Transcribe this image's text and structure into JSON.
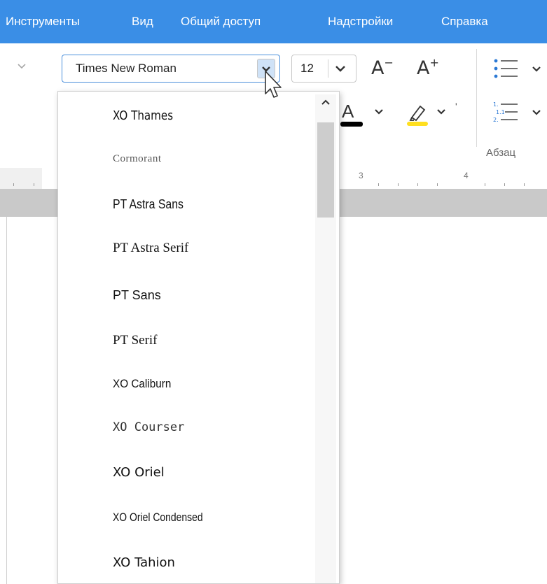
{
  "menubar": {
    "items": [
      "Инструменты",
      "Вид",
      "Общий доступ",
      "Надстройки",
      "Справка"
    ]
  },
  "toolbar": {
    "font_name": {
      "value": "Times New Roman"
    },
    "font_size": {
      "value": "12"
    },
    "decrease_font_label": "A",
    "decrease_font_mark": "−",
    "increase_font_label": "A",
    "increase_font_mark": "+",
    "font_color_letter": "A",
    "font_color": "#000000",
    "highlight_color": "#ffdf1f",
    "paragraph_group_label": "Абзац"
  },
  "ruler": {
    "marks": [
      "3",
      "4"
    ]
  },
  "font_dropdown": {
    "items": [
      "XO Thames",
      "Cormorant",
      "PT Astra Sans",
      "PT Astra Serif",
      "PT Sans",
      "PT Serif",
      "XO Caliburn",
      "XO Courser",
      "XO Oriel",
      "XO Oriel Condensed",
      "XO Tahion"
    ]
  },
  "colors": {
    "menubar_bg": "#3a8ee6",
    "accent_border": "#4a8fdb"
  }
}
